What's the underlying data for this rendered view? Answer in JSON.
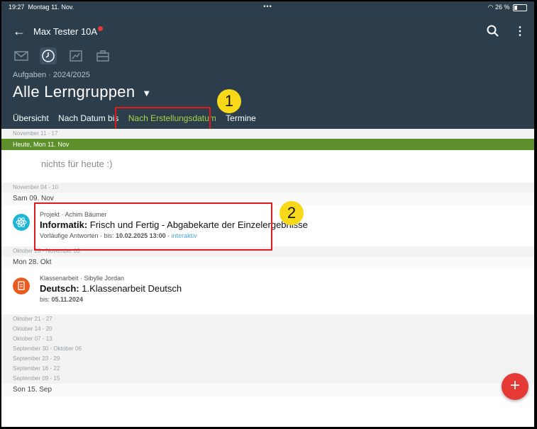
{
  "status_bar": {
    "time": "19:27",
    "date": "Montag 11. Nov.",
    "battery": "26 %"
  },
  "nav": {
    "back_icon": "arrow-left-icon",
    "title": "Max Tester 10A",
    "search_icon": "search-icon",
    "menu_icon": "more-vert-icon"
  },
  "section_icons": [
    "mail-icon",
    "clock-icon",
    "chart-icon",
    "briefcase-icon"
  ],
  "header": {
    "subtitle": "Aufgaben · 2024/2025",
    "title": "Alle Lerngruppen"
  },
  "tabs": [
    {
      "label": "Übersicht"
    },
    {
      "label": "Nach Datum bis"
    },
    {
      "label": "Nach Erstellungsdatum"
    },
    {
      "label": "Termine"
    }
  ],
  "annotations": {
    "badge1": "1",
    "badge2": "2"
  },
  "list": {
    "week_nov11": "November 11 - 17",
    "today_label": "Heute, Mon 11. Nov",
    "empty_text": "nichts für heute :)",
    "week_nov04": "November 04 - 10",
    "day_sat": "Sam 09. Nov",
    "item1": {
      "meta": "Projekt · Achim Bäumer",
      "subject": "Informatik:",
      "title": " Frisch und Fertig - Abgabekarte der Einzelergebnisse",
      "info_prefix": "Vorläufige Antworten · bis: ",
      "due": "10.02.2025 13:00",
      "info_sep": " · ",
      "tag": "interaktiv"
    },
    "week_oct28": "Oktober 28 - November 03",
    "day_mon": "Mon 28. Okt",
    "item2": {
      "meta": "Klassenarbeit · Sibylle Jordan",
      "subject": "Deutsch:",
      "title": " 1.Klassenarbeit Deutsch",
      "info_prefix": "bis: ",
      "due": "05.11.2024"
    },
    "older_weeks": [
      "Oktober 21 - 27",
      "Oktober 14 - 20",
      "Oktober 07 - 13",
      "September 30 - Oktober 06",
      "September 23 - 29",
      "September 16 - 22",
      "September 09 - 15"
    ],
    "day_sun": "Son 15. Sep"
  },
  "fab": {
    "label": "+"
  }
}
